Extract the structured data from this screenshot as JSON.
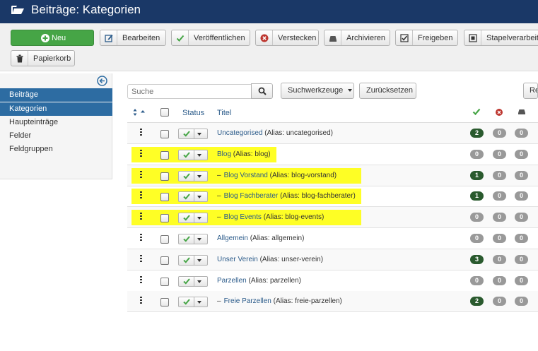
{
  "header": {
    "title": "Beiträge: Kategorien",
    "icon": "folder-open-icon"
  },
  "toolbar": {
    "new": "Neu",
    "edit": "Bearbeiten",
    "publish": "Veröffentlichen",
    "unpublish": "Verstecken",
    "archive": "Archivieren",
    "checkin": "Freigeben",
    "batch": "Stapelverarbeitung",
    "trash": "Papierkorb"
  },
  "sidebar": {
    "items": [
      {
        "label": "Beiträge",
        "active": true
      },
      {
        "label": "Kategorien",
        "active": true
      },
      {
        "label": "Haupteinträge",
        "active": false
      },
      {
        "label": "Felder",
        "active": false
      },
      {
        "label": "Feldgruppen",
        "active": false
      }
    ]
  },
  "filters": {
    "search_placeholder": "Suche",
    "search_tools": "Suchwerkzeuge",
    "reset": "Zurücksetzen",
    "right_partial": "Re"
  },
  "table": {
    "headers": {
      "status": "Status",
      "title": "Titel"
    },
    "rows": [
      {
        "prefix": "",
        "title": "Uncategorised",
        "alias": "(Alias: uncategorised)",
        "published": "2",
        "unpublished": "0",
        "archived": "0",
        "highlight": false
      },
      {
        "prefix": "",
        "title": "Blog",
        "alias": "(Alias: blog)",
        "published": "0",
        "unpublished": "0",
        "archived": "0",
        "highlight": true
      },
      {
        "prefix": "–",
        "title": "Blog Vorstand",
        "alias": "(Alias: blog-vorstand)",
        "published": "1",
        "unpublished": "0",
        "archived": "0",
        "highlight": true
      },
      {
        "prefix": "–",
        "title": "Blog Fachberater",
        "alias": "(Alias: blog-fachberater)",
        "published": "1",
        "unpublished": "0",
        "archived": "0",
        "highlight": true
      },
      {
        "prefix": "–",
        "title": "Blog Events",
        "alias": "(Alias: blog-events)",
        "published": "0",
        "unpublished": "0",
        "archived": "0",
        "highlight": true
      },
      {
        "prefix": "",
        "title": "Allgemein",
        "alias": "(Alias: allgemein)",
        "published": "0",
        "unpublished": "0",
        "archived": "0",
        "highlight": false
      },
      {
        "prefix": "",
        "title": "Unser Verein",
        "alias": "(Alias: unser-verein)",
        "published": "3",
        "unpublished": "0",
        "archived": "0",
        "highlight": false
      },
      {
        "prefix": "",
        "title": "Parzellen",
        "alias": "(Alias: parzellen)",
        "published": "0",
        "unpublished": "0",
        "archived": "0",
        "highlight": false
      },
      {
        "prefix": "–",
        "title": "Freie Parzellen",
        "alias": "(Alias: freie-parzellen)",
        "published": "2",
        "unpublished": "0",
        "archived": "0",
        "highlight": false
      }
    ]
  },
  "colors": {
    "header_bg": "#1a3867",
    "sidebar_active": "#2d6ca2",
    "new_button": "#46a546",
    "highlight": "#ffff00",
    "badge_green": "#2a5a2e",
    "badge_grey": "#999999"
  }
}
